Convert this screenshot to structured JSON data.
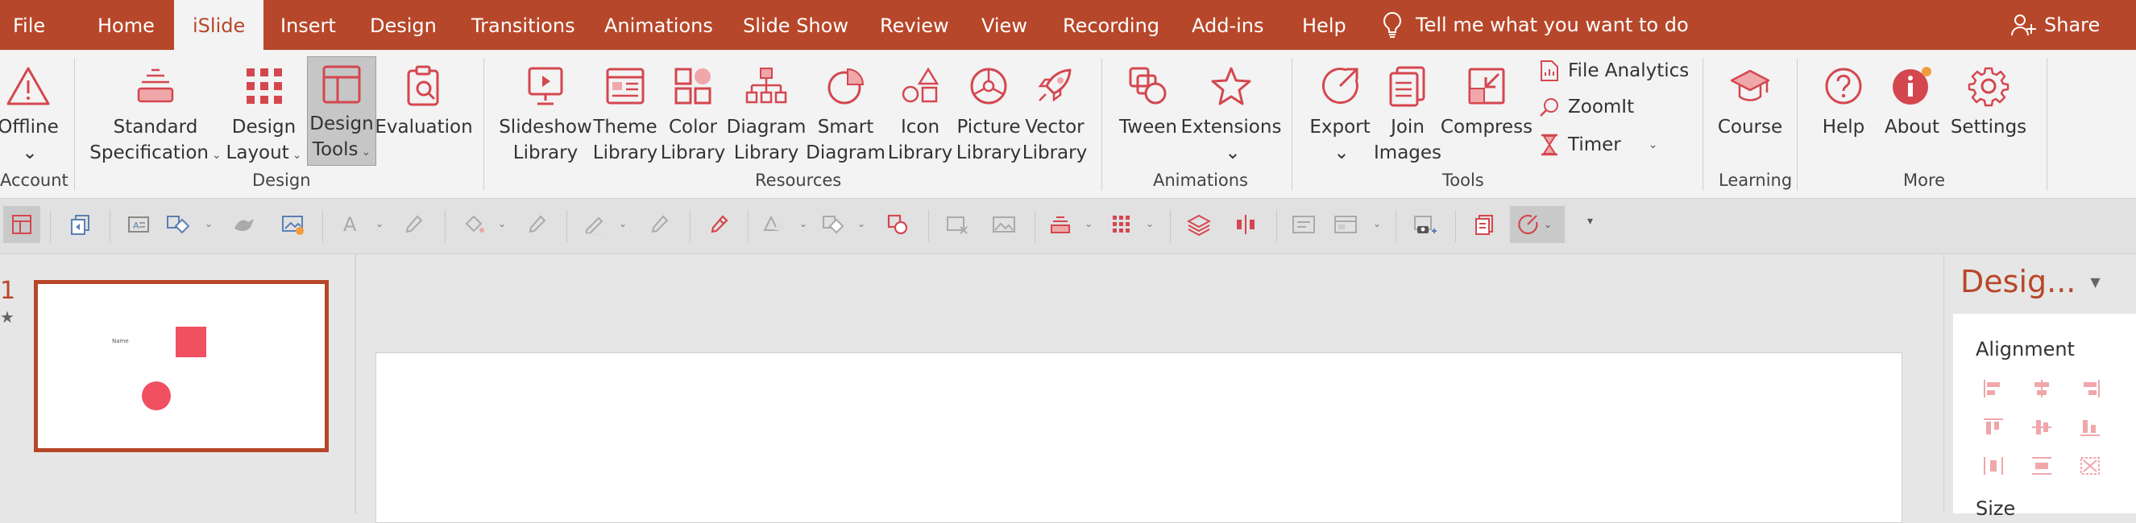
{
  "menu": {
    "tabs": [
      "File",
      "Home",
      "iSlide",
      "Insert",
      "Design",
      "Transitions",
      "Animations",
      "Slide Show",
      "Review",
      "View",
      "Recording",
      "Add-ins",
      "Help"
    ],
    "active_tab": "iSlide",
    "tell_me": "Tell me what you want to do",
    "share": "Share"
  },
  "ribbon": {
    "account": {
      "offline": "Offline",
      "group": "Account"
    },
    "design": {
      "standard": [
        "Standard",
        "Specification"
      ],
      "layout": [
        "Design",
        "Layout"
      ],
      "tools": [
        "Design",
        "Tools"
      ],
      "evaluation": "Evaluation",
      "group": "Design"
    },
    "resources": {
      "slideshow": [
        "Slideshow",
        "Library"
      ],
      "theme": [
        "Theme",
        "Library"
      ],
      "color": [
        "Color",
        "Library"
      ],
      "diagram": [
        "Diagram",
        "Library"
      ],
      "smart": [
        "Smart",
        "Diagram"
      ],
      "icon": [
        "Icon",
        "Library"
      ],
      "picture": [
        "Picture",
        "Library"
      ],
      "vector": [
        "Vector",
        "Library"
      ],
      "group": "Resources"
    },
    "animations": {
      "tween": "Tween",
      "extensions": "Extensions",
      "group": "Animations"
    },
    "tools": {
      "export": "Export",
      "join": [
        "Join",
        "Images"
      ],
      "compress": "Compress",
      "file_analytics": "File Analytics",
      "zoomit": "ZoomIt",
      "timer": "Timer",
      "group": "Tools"
    },
    "learning": {
      "course": "Course",
      "group": "Learning"
    },
    "more": {
      "help": "Help",
      "about": "About",
      "settings": "Settings",
      "group": "More"
    }
  },
  "slides": {
    "number": "1",
    "star": "★",
    "thumb_text": "Name"
  },
  "right_panel": {
    "title": "Desig...",
    "alignment": "Alignment",
    "size": "Size"
  },
  "colors": {
    "accent": "#b7472a",
    "icon": "#d4474f",
    "light_icon": "#f0a7aa"
  }
}
